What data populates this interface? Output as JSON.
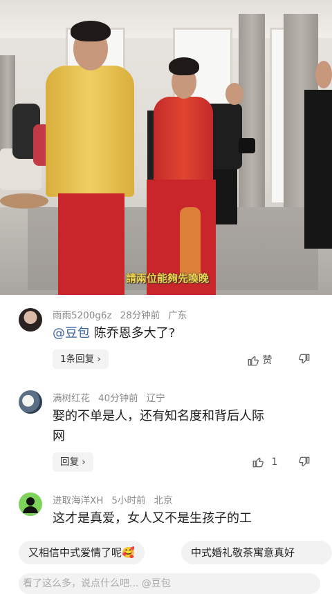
{
  "video": {
    "subtitle": "請兩位能夠先喚晚"
  },
  "comments": [
    {
      "username": "雨雨5200g6z",
      "time": "28分钟前",
      "location": "广东",
      "mention": "@豆包",
      "text": " 陈乔恩多大了?",
      "reply_label": "1条回复 ›",
      "like_label": "赞",
      "like_count": ""
    },
    {
      "username": "满树红花",
      "time": "40分钟前",
      "location": "辽宁",
      "text_line1": "娶的不单是人，还有知名度和背后人际",
      "text_line2": "网",
      "reply_label": "回复 ›",
      "like_count": "1"
    },
    {
      "username": "进取海洋XH",
      "time": "5小时前",
      "location": "北京",
      "text_line1": "这才是真爱，女人又不是生孩子的工"
    }
  ],
  "suggestions": [
    "又相信中式爱情了呢🥰",
    "中式婚礼敬茶寓意真好"
  ],
  "input": {
    "placeholder": "看了这么多，说点什么吧... @豆包"
  },
  "colors": {
    "mention": "#3a63a5",
    "subtitle": "#f2d64b",
    "groom_robe": "#e8c34e",
    "skirt": "#c8262a"
  }
}
